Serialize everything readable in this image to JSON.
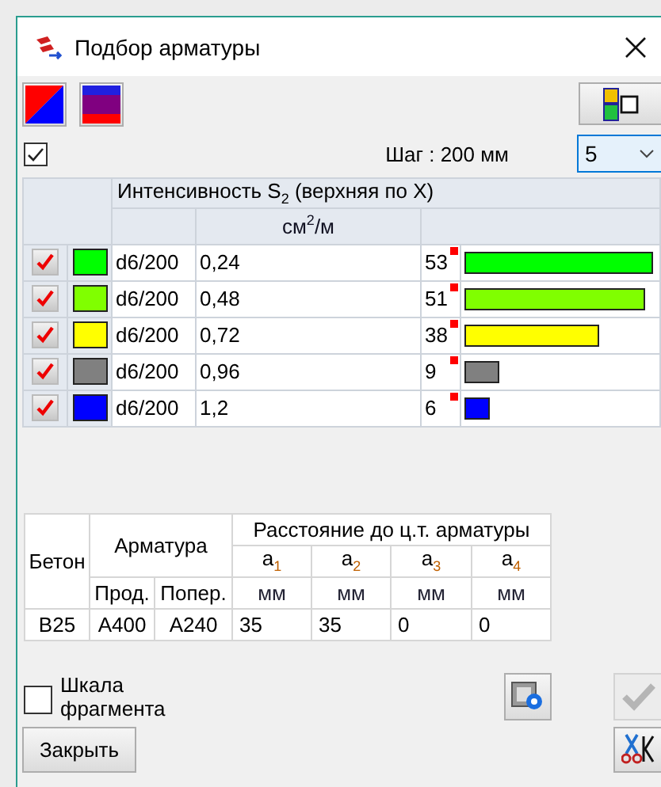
{
  "window": {
    "title": "Подбор арматуры"
  },
  "toolbar": {
    "show_all_checked": true,
    "step_label": "Шаг : 200 мм",
    "count_select": {
      "value": "5",
      "focused": true
    }
  },
  "intensity_table": {
    "title": "Интенсивность S$_{2}$ (верхняя по X)",
    "unit": "см$^{2}$/м",
    "rows": [
      {
        "checked": true,
        "color": "#00ff00",
        "rebar": "d6/200",
        "value": "0,24",
        "count": "53",
        "level": 0.98
      },
      {
        "checked": true,
        "color": "#80ff00",
        "rebar": "d6/200",
        "value": "0,48",
        "count": "51",
        "level": 0.94
      },
      {
        "checked": true,
        "color": "#ffff00",
        "rebar": "d6/200",
        "value": "0,72",
        "count": "38",
        "level": 0.7
      },
      {
        "checked": true,
        "color": "#808080",
        "rebar": "d6/200",
        "value": "0,96",
        "count": "9",
        "level": 0.18
      },
      {
        "checked": true,
        "color": "#0000ff",
        "rebar": "d6/200",
        "value": "1,2",
        "count": "6",
        "level": 0.13
      }
    ]
  },
  "rebar_table": {
    "concrete_header": "Бетон",
    "rebar_header": "Арматура",
    "distance_header": "Расстояние до ц.т. арматуры",
    "rebar_subheaders": [
      "Прод.",
      "Попер."
    ],
    "distance_columns": [
      "a$_{1}$",
      "a$_{2}$",
      "a$_{3}$",
      "a$_{4}$"
    ],
    "units": [
      "мм",
      "мм",
      "мм",
      "мм"
    ],
    "row": [
      "B25",
      "A400",
      "A240",
      "35",
      "35",
      "0",
      "0"
    ]
  },
  "scale_checkbox": {
    "label": "Шкала фрагмента",
    "checked": false
  },
  "apply_button": {
    "disabled": true
  },
  "close_button": {
    "label": "Закрыть"
  }
}
